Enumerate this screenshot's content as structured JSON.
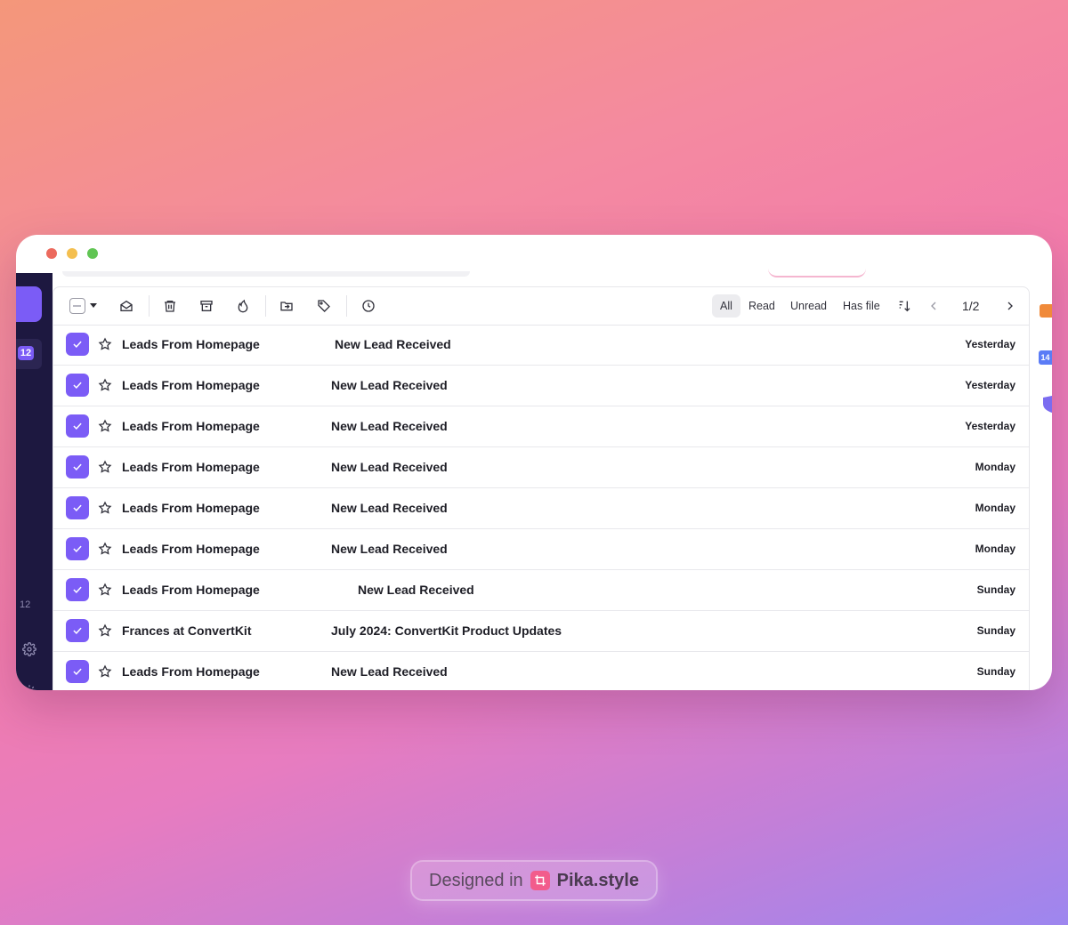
{
  "app": {
    "sidebar": {
      "badge_count": "12",
      "count_label": "12"
    },
    "toolbar": {
      "filters": [
        {
          "label": "All",
          "active": true
        },
        {
          "label": "Read",
          "active": false
        },
        {
          "label": "Unread",
          "active": false
        },
        {
          "label": "Has file",
          "active": false
        }
      ],
      "pagination": "1/2"
    },
    "right_edge": {
      "badge": "14"
    },
    "emails": [
      {
        "sender": "Leads From Homepage",
        "subject": "New Lead Received",
        "date": "Yesterday",
        "checked": true
      },
      {
        "sender": "Leads From Homepage",
        "subject": "New Lead Received",
        "date": "Yesterday",
        "checked": true
      },
      {
        "sender": "Leads From Homepage",
        "subject": "New Lead Received",
        "date": "Yesterday",
        "checked": true
      },
      {
        "sender": "Leads From Homepage",
        "subject": "New Lead Received",
        "date": "Monday",
        "checked": true
      },
      {
        "sender": "Leads From Homepage",
        "subject": "New Lead Received",
        "date": "Monday",
        "checked": true
      },
      {
        "sender": "Leads From Homepage",
        "subject": "New Lead Received",
        "date": "Monday",
        "checked": true
      },
      {
        "sender": "Leads From Homepage",
        "subject": "New Lead Received",
        "date": "Sunday",
        "checked": true
      },
      {
        "sender": "Frances at ConvertKit",
        "subject": "July 2024: ConvertKit Product Updates",
        "date": "Sunday",
        "checked": true
      },
      {
        "sender": "Leads From Homepage",
        "subject": "New Lead Received",
        "date": "Sunday",
        "checked": true
      }
    ]
  },
  "credit": {
    "prefix": "Designed in",
    "brand": "Pika.style"
  },
  "colors": {
    "accent": "#7b5cf6",
    "sidebar_bg": "#1d1840"
  }
}
